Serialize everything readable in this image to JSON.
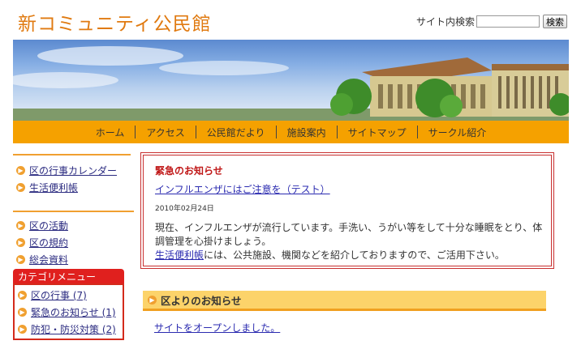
{
  "site": {
    "title": "新コミュニティ公民館"
  },
  "search": {
    "label": "サイト内検索",
    "button": "検索"
  },
  "nav": [
    "ホーム",
    "アクセス",
    "公民館だより",
    "施設案内",
    "サイトマップ",
    "サークル紹介"
  ],
  "sidebar": {
    "group1": [
      "区の行事カレンダー",
      "生活便利帳"
    ],
    "group2": [
      "区の活動",
      "区の規約",
      "総会資料"
    ],
    "category_title": "カテゴリメニュー",
    "categories": [
      "区の行事 (7)",
      "緊急のお知らせ (1)",
      "防犯・防災対策 (2)"
    ]
  },
  "urgent": {
    "title": "緊急のお知らせ",
    "link": "インフルエンザにはご注意を（テスト）",
    "date": "2010年02月24日",
    "body_line": "現在、インフルエンザが流行しています。手洗い、うがい等をして十分な睡眠をとり、体調管理を心掛けましょう。",
    "body_link": "生活便利帳",
    "body_rest": "には、公共施設、機関などを紹介しておりますので、ご活用下さい。"
  },
  "news": {
    "title": "区よりのお知らせ",
    "item": "サイトをオープンしました。"
  },
  "colors": {
    "accent": "#f5a100",
    "category_red": "#e0201e",
    "link": "#2b2bb0"
  }
}
